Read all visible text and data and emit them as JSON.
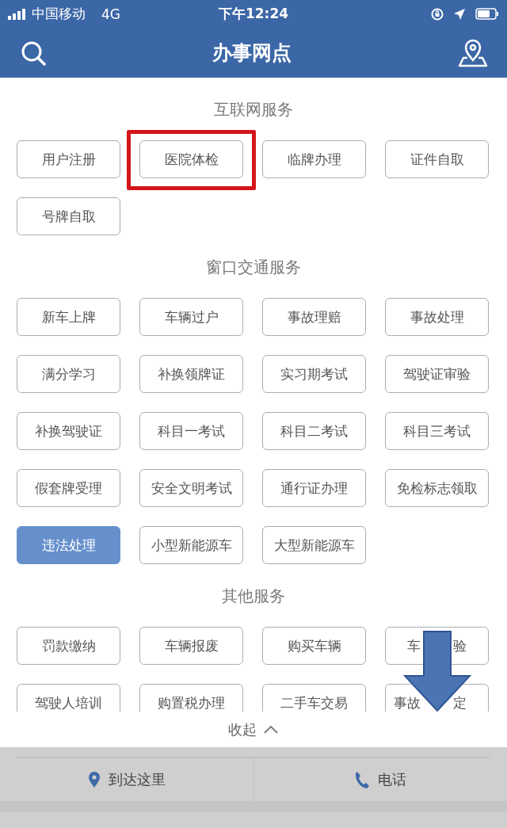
{
  "status_bar": {
    "carrier": "中国移动",
    "network": "4G",
    "time": "下午12:24"
  },
  "nav": {
    "title": "办事网点"
  },
  "sections": [
    {
      "title": "互联网服务",
      "buttons": [
        {
          "label": "用户注册",
          "selected": false,
          "highlighted": false
        },
        {
          "label": "医院体检",
          "selected": false,
          "highlighted": true
        },
        {
          "label": "临牌办理",
          "selected": false,
          "highlighted": false
        },
        {
          "label": "证件自取",
          "selected": false,
          "highlighted": false
        },
        {
          "label": "号牌自取",
          "selected": false,
          "highlighted": false
        }
      ]
    },
    {
      "title": "窗口交通服务",
      "buttons": [
        {
          "label": "新车上牌",
          "selected": false,
          "highlighted": false
        },
        {
          "label": "车辆过户",
          "selected": false,
          "highlighted": false
        },
        {
          "label": "事故理赔",
          "selected": false,
          "highlighted": false
        },
        {
          "label": "事故处理",
          "selected": false,
          "highlighted": false
        },
        {
          "label": "满分学习",
          "selected": false,
          "highlighted": false
        },
        {
          "label": "补换领牌证",
          "selected": false,
          "highlighted": false
        },
        {
          "label": "实习期考试",
          "selected": false,
          "highlighted": false
        },
        {
          "label": "驾驶证审验",
          "selected": false,
          "highlighted": false
        },
        {
          "label": "补换驾驶证",
          "selected": false,
          "highlighted": false
        },
        {
          "label": "科目一考试",
          "selected": false,
          "highlighted": false
        },
        {
          "label": "科目二考试",
          "selected": false,
          "highlighted": false
        },
        {
          "label": "科目三考试",
          "selected": false,
          "highlighted": false
        },
        {
          "label": "假套牌受理",
          "selected": false,
          "highlighted": false
        },
        {
          "label": "安全文明考试",
          "selected": false,
          "highlighted": false
        },
        {
          "label": "通行证办理",
          "selected": false,
          "highlighted": false
        },
        {
          "label": "免检标志领取",
          "selected": false,
          "highlighted": false
        },
        {
          "label": "违法处理",
          "selected": true,
          "highlighted": false
        },
        {
          "label": "小型新能源车",
          "selected": false,
          "highlighted": false
        },
        {
          "label": "大型新能源车",
          "selected": false,
          "highlighted": false
        }
      ]
    },
    {
      "title": "其他服务",
      "buttons": [
        {
          "label": "罚款缴纳",
          "selected": false,
          "highlighted": false
        },
        {
          "label": "车辆报废",
          "selected": false,
          "highlighted": false
        },
        {
          "label": "购买车辆",
          "selected": false,
          "highlighted": false
        },
        {
          "label_parts": [
            "车",
            "验"
          ],
          "selected": false,
          "highlighted": false
        },
        {
          "label": "驾驶人培训",
          "selected": false,
          "highlighted": false
        },
        {
          "label": "购置税办理",
          "selected": false,
          "highlighted": false
        },
        {
          "label": "二手车交易",
          "selected": false,
          "highlighted": false
        },
        {
          "label_parts": [
            "事故",
            "定"
          ],
          "selected": false,
          "highlighted": false
        }
      ]
    }
  ],
  "collapse": {
    "label": "收起"
  },
  "actions": [
    {
      "kind": "directions",
      "label": "到达这里"
    },
    {
      "kind": "call",
      "label": "电话"
    }
  ],
  "annotations": [
    {
      "kind": "down-arrow"
    }
  ]
}
